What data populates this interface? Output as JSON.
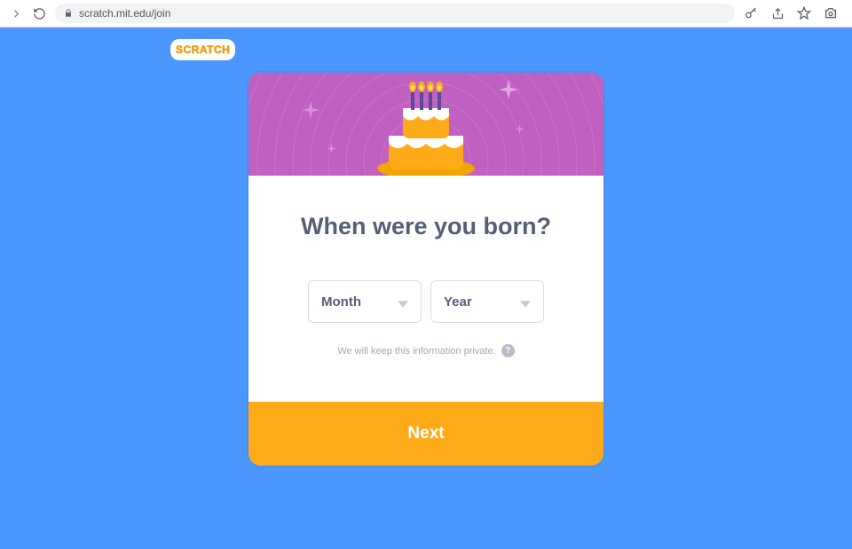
{
  "browser": {
    "url": "scratch.mit.edu/join"
  },
  "logo": {
    "text": "SCRATCH"
  },
  "card": {
    "title": "When were you born?",
    "month_label": "Month",
    "year_label": "Year",
    "privacy_text": "We will keep this information private.",
    "help_char": "?",
    "next_label": "Next"
  }
}
